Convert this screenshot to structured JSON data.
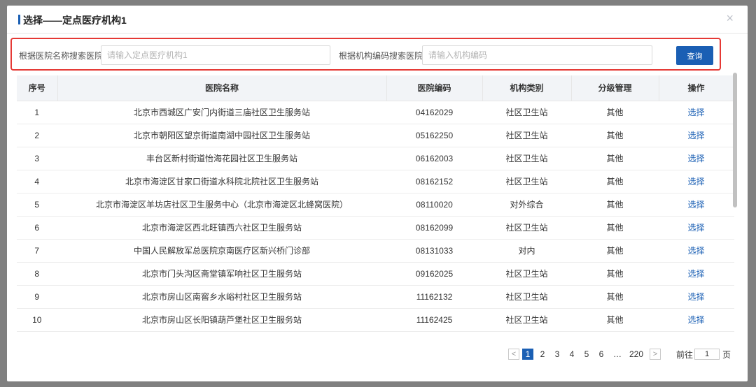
{
  "modal": {
    "title": "选择——定点医疗机构1",
    "close_glyph": "×"
  },
  "search": {
    "name_label": "根据医院名称搜索医院",
    "name_placeholder": "请输入定点医疗机构1",
    "code_label": "根据机构编码搜索医院",
    "code_placeholder": "请输入机构编码",
    "query_label": "查询"
  },
  "table": {
    "headers": [
      "序号",
      "医院名称",
      "医院编码",
      "机构类别",
      "分级管理",
      "操作"
    ],
    "rows": [
      {
        "no": "1",
        "name": "北京市西城区广安门内街道三庙社区卫生服务站",
        "code": "04162029",
        "type": "社区卫生站",
        "level": "其他",
        "action": "选择"
      },
      {
        "no": "2",
        "name": "北京市朝阳区望京街道南湖中园社区卫生服务站",
        "code": "05162250",
        "type": "社区卫生站",
        "level": "其他",
        "action": "选择"
      },
      {
        "no": "3",
        "name": "丰台区新村街道怡海花园社区卫生服务站",
        "code": "06162003",
        "type": "社区卫生站",
        "level": "其他",
        "action": "选择"
      },
      {
        "no": "4",
        "name": "北京市海淀区甘家口街道水科院北院社区卫生服务站",
        "code": "08162152",
        "type": "社区卫生站",
        "level": "其他",
        "action": "选择"
      },
      {
        "no": "5",
        "name": "北京市海淀区羊坊店社区卫生服务中心（北京市海淀区北蜂窝医院）",
        "code": "08110020",
        "type": "对外综合",
        "level": "其他",
        "action": "选择"
      },
      {
        "no": "6",
        "name": "北京市海淀区西北旺镇西六社区卫生服务站",
        "code": "08162099",
        "type": "社区卫生站",
        "level": "其他",
        "action": "选择"
      },
      {
        "no": "7",
        "name": "中国人民解放军总医院京南医疗区新兴桥门诊部",
        "code": "08131033",
        "type": "对内",
        "level": "其他",
        "action": "选择"
      },
      {
        "no": "8",
        "name": "北京市门头沟区斋堂镇军响社区卫生服务站",
        "code": "09162025",
        "type": "社区卫生站",
        "level": "其他",
        "action": "选择"
      },
      {
        "no": "9",
        "name": "北京市房山区南窖乡水峪村社区卫生服务站",
        "code": "11162132",
        "type": "社区卫生站",
        "level": "其他",
        "action": "选择"
      },
      {
        "no": "10",
        "name": "北京市房山区长阳镇葫芦堡社区卫生服务站",
        "code": "11162425",
        "type": "社区卫生站",
        "level": "其他",
        "action": "选择"
      }
    ]
  },
  "pagination": {
    "prev": "<",
    "next": ">",
    "pages": [
      "1",
      "2",
      "3",
      "4",
      "5",
      "6"
    ],
    "ellipsis": "…",
    "last_page": "220",
    "current": "1",
    "goto_label": "前往",
    "goto_value": "1",
    "page_suffix": "页"
  },
  "colors": {
    "accent": "#1a5fb4",
    "highlight_border": "#e53935"
  }
}
